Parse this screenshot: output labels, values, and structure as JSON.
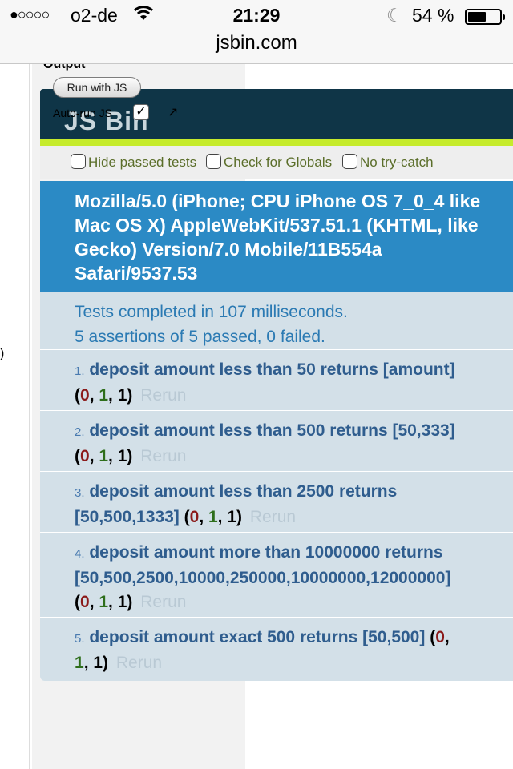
{
  "status": {
    "signal": "●○○○○",
    "carrier": "o2-de",
    "time": "21:29",
    "battery": "54 %"
  },
  "browser": {
    "url": "jsbin.com"
  },
  "sidebar": {
    "paren": ")"
  },
  "output": {
    "label": "Output",
    "run_button": "Run with JS",
    "autorun_label": "Auto-run JS",
    "logo": "JS Bin"
  },
  "toolbar": {
    "hide_passed": "Hide passed tests",
    "check_globals": "Check for Globals",
    "no_try_catch": "No try-catch"
  },
  "useragent": {
    "line1": "Mozilla/5.0 (iPhone; CPU iPhone OS 7_0_4 like",
    "line2": "Mac OS X) AppleWebKit/537.51.1 (KHTML, like",
    "line3": "Gecko) Version/7.0 Mobile/11B554a",
    "line4": "Safari/9537.53"
  },
  "summary": {
    "line1": "Tests completed in 107 milliseconds.",
    "line2": "5 assertions of 5 passed, 0 failed."
  },
  "tests": [
    {
      "num": "1.",
      "line1": "deposit amount less than 50 returns [amount]",
      "line2": "",
      "failed": "0",
      "passed": "1",
      "total": "1",
      "rerun": "Rerun"
    },
    {
      "num": "2.",
      "line1": "deposit amount less than 500 returns [50,333]",
      "line2": "",
      "failed": "0",
      "passed": "1",
      "total": "1",
      "rerun": "Rerun"
    },
    {
      "num": "3.",
      "line1": "deposit amount less than 2500 returns",
      "line2": "[50,500,1333]",
      "failed": "0",
      "passed": "1",
      "total": "1",
      "rerun": "Rerun"
    },
    {
      "num": "4.",
      "line1": "deposit amount more than 10000000 returns",
      "line2": "[50,500,2500,10000,250000,10000000,12000000]",
      "failed": "0",
      "passed": "1",
      "total": "1",
      "rerun": "Rerun"
    },
    {
      "num": "5.",
      "line1": "deposit amount exact 500 returns [50,500]",
      "line2": "",
      "failed": "0",
      "passed": "1",
      "total": "1",
      "rerun": "Rerun"
    }
  ]
}
